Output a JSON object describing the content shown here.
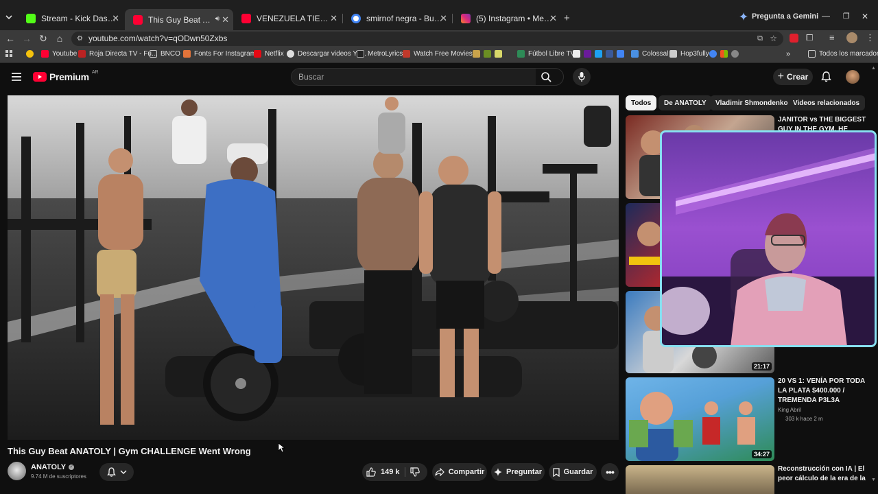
{
  "browser": {
    "tabs": [
      {
        "title": "Stream - Kick Dashboard",
        "favicon_color": "#53fc18"
      },
      {
        "title": "This Guy Beat ANATOLY | G",
        "favicon_color": "#ff0033"
      },
      {
        "title": "VENEZUELA TIEMBLA: dentro d",
        "favicon_color": "#ff0033"
      },
      {
        "title": "smirnof negra - Buscar con Goo",
        "favicon_color": "#4285f4"
      },
      {
        "title": "(5) Instagram • Mensajes",
        "favicon_color": "#e1306c"
      }
    ],
    "gemini_label": "Pregunta a Gemini",
    "url": "youtube.com/watch?v=qODwn50Zxbs",
    "bookmarks": [
      "Youtube",
      "Roja Directa TV - Fu...",
      "BNCO",
      "Fonts For Instagram...",
      "Netflix",
      "Descargar videos Yo...",
      "MetroLyrics",
      "Watch Free Movies...",
      "Fútbol Libre TV",
      "Colossal",
      "Hop3fully"
    ],
    "all_bookmarks_label": "Todos los marcadores"
  },
  "youtube": {
    "logo_text": "Premium",
    "logo_badge": "AR",
    "search_placeholder": "Buscar",
    "create_label": "Crear"
  },
  "video": {
    "title": "This Guy Beat ANATOLY | Gym CHALLENGE Went Wrong",
    "channel_name": "ANATOLY",
    "subscribers": "9.74 M de suscriptores",
    "likes": "149 k",
    "share_label": "Compartir",
    "ask_label": "Preguntar",
    "save_label": "Guardar"
  },
  "chips": [
    "Todos",
    "De ANATOLY",
    "Vladimir Shmondenko",
    "Videos relacionados"
  ],
  "related": [
    {
      "title": "JANITOR vs THE BIGGEST GUY IN THE GYM. HE Didn't",
      "duration": ""
    },
    {
      "title": "",
      "duration": ""
    },
    {
      "title": "",
      "duration": "21:17"
    },
    {
      "title": "20 VS 1: VENÍA POR TODA LA PLATA $400.000 / TREMENDA P3L3A",
      "channel": "King Abril",
      "meta": "303 k  hace 2 m",
      "duration": "34:27"
    },
    {
      "title": "Reconstrucción con IA | El peor cálculo de la era de la",
      "duration": ""
    }
  ],
  "icons": [
    "menu-icon",
    "search-icon",
    "mic-icon",
    "bell-icon",
    "like-icon",
    "dislike-icon",
    "share-icon",
    "sparkle-icon",
    "bookmark-icon",
    "more-icon"
  ]
}
